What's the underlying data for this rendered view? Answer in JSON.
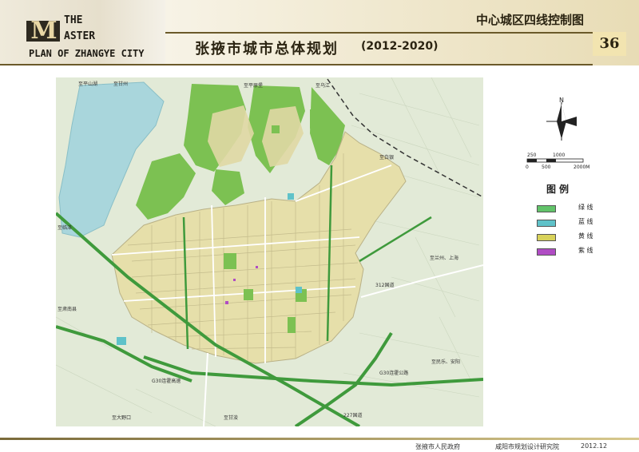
{
  "header": {
    "logo_mark": "M",
    "logo_line1": "THE",
    "logo_line2": "ASTER",
    "logo_line3": "PLAN OF ZHANGYE CITY",
    "subtitle": "中心城区四线控制图",
    "title": "张掖市城市总体规划",
    "years": "(2012-2020)",
    "page_number": "36"
  },
  "map": {
    "road_labels": [
      "至平山湖",
      "至甘州",
      "至平原堡",
      "至乌江",
      "至白银",
      "至兰州、上海",
      "312国道",
      "至临泽",
      "至肃南县",
      "G30连霍高速",
      "G30连霍公路",
      "227国道",
      "至民乐、安阳",
      "至大野口",
      "至甘浚"
    ],
    "colors": {
      "background": "#e2ead7",
      "urban": "#e6dfaa",
      "green": "#7cc152",
      "water": "#a9d6dc",
      "highway": "#3f9a3c"
    }
  },
  "north_arrow": {
    "label": "N"
  },
  "scale_bar": {
    "upper_labels": [
      "250",
      "1000"
    ],
    "lower_labels": [
      "0",
      "500",
      "2000M"
    ]
  },
  "legend": {
    "title": "图例",
    "items": [
      {
        "label": "绿 线",
        "color": "#62c36a"
      },
      {
        "label": "蓝 线",
        "color": "#5fc2c9"
      },
      {
        "label": "黄 线",
        "color": "#d8d25a"
      },
      {
        "label": "紫 线",
        "color": "#b04cc4"
      }
    ]
  },
  "footer": {
    "government": "张掖市人民政府",
    "institute": "咸阳市规划设计研究院",
    "date": "2012.12"
  }
}
